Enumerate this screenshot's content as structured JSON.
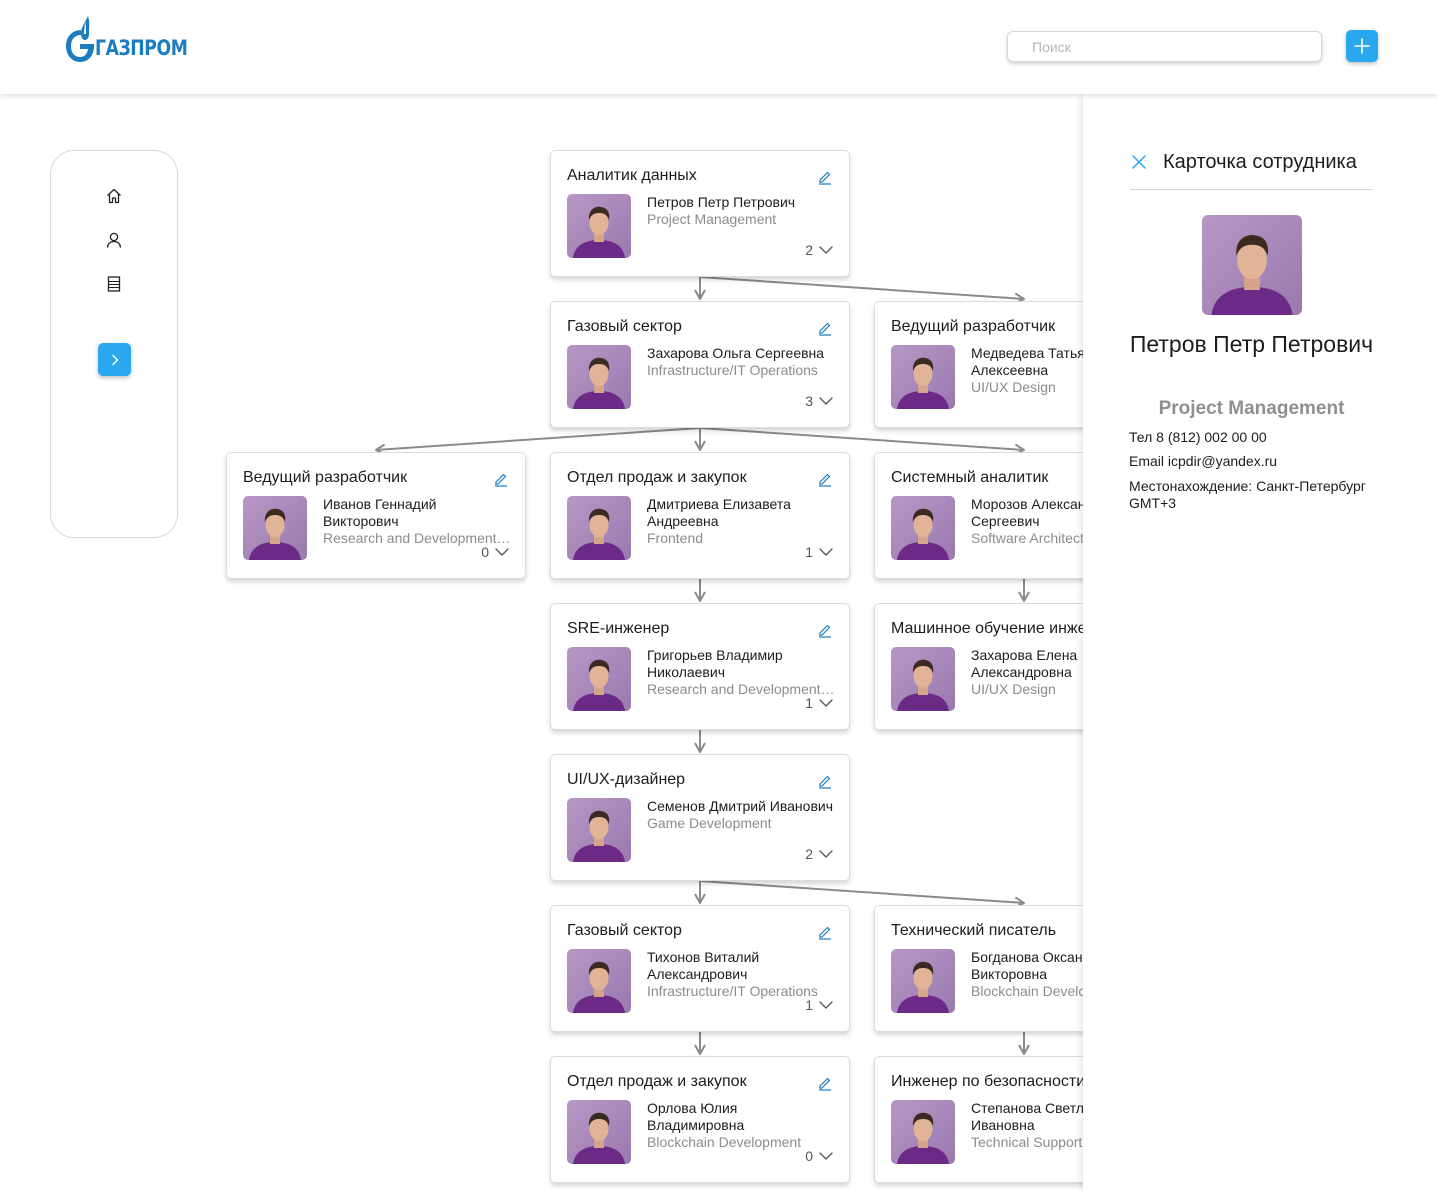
{
  "header": {
    "logo_text": "ГАЗПРОМ",
    "search_placeholder": "Поиск",
    "colors": {
      "accent": "#2aa8ef",
      "brand": "#1b7cc0"
    }
  },
  "sidebar": {
    "items": [
      {
        "name": "home",
        "icon": "home-icon"
      },
      {
        "name": "profile",
        "icon": "user-icon"
      },
      {
        "name": "documents",
        "icon": "list-icon"
      }
    ],
    "expand_icon": "chevron-right-icon"
  },
  "cards": [
    {
      "title": "Аналитик данных",
      "name": "Петров Петр Петрович",
      "dept": "Project Management",
      "count": "2"
    },
    {
      "title": "Газовый сектор",
      "name": "Захарова Ольга Сергеевна",
      "dept": "Infrastructure/IT Operations",
      "count": "3"
    },
    {
      "title": "Ведущий разработчик",
      "name": "Медведева Татьяна Алексеевна",
      "dept": "UI/UX Design",
      "count": ""
    },
    {
      "title": "Ведущий разработчик",
      "name": "Иванов Геннадий Викторович",
      "dept": "Research and Development Team",
      "count": "0"
    },
    {
      "title": "Отдел продаж и закупок",
      "name": "Дмитриева Елизавета Андреевна",
      "dept": "Frontend",
      "count": "1"
    },
    {
      "title": "Системный аналитик",
      "name": "Морозов Александр Сергеевич",
      "dept": "Software Architecture",
      "count": ""
    },
    {
      "title": "SRE-инженер",
      "name": "Григорьев Владимир Николаевич",
      "dept": "Research and Development Team",
      "count": "1"
    },
    {
      "title": "Машинное обучение инженер",
      "name": "Захарова Елена Александровна",
      "dept": "UI/UX Design",
      "count": ""
    },
    {
      "title": "UI/UX-дизайнер",
      "name": "Семенов Дмитрий Иванович",
      "dept": "Game Development",
      "count": "2"
    },
    {
      "title": "Газовый сектор",
      "name": "Тихонов Виталий Александрович",
      "dept": "Infrastructure/IT Operations",
      "count": "1"
    },
    {
      "title": "Технический писатель",
      "name": "Богданова Оксана Викторовна",
      "dept": "Blockchain Development",
      "count": ""
    },
    {
      "title": "Отдел продаж и закупок",
      "name": "Орлова Юлия Владимировна",
      "dept": "Blockchain Development",
      "count": "0"
    },
    {
      "title": "Инженер по безопасности",
      "name": "Степанова Светлана Ивановна",
      "dept": "Technical Support",
      "count": ""
    }
  ],
  "panel": {
    "title": "Карточка сотрудника",
    "name": "Петров Петр Петрович",
    "dept": "Project Management",
    "phone": "Тел 8 (812) 002 00 00",
    "email": "Email icpdir@yandex.ru",
    "location": "Местонахождение: Санкт-Петербург GMT+3"
  }
}
